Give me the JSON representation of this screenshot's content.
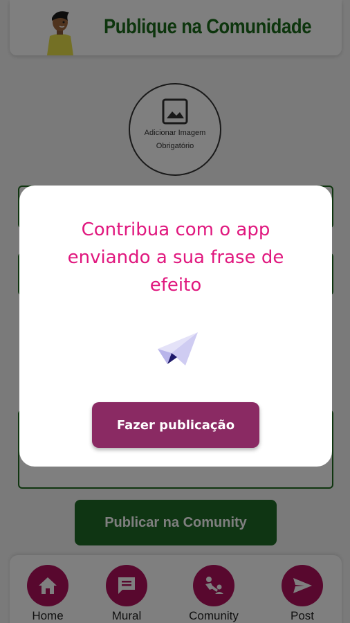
{
  "header": {
    "title": "Publique na Comunidade",
    "avatar_icon": "person-avatar-icon"
  },
  "image_picker": {
    "label_line1": "Adicionar Imagem",
    "label_line2": "Obrigatório",
    "icon": "image-icon"
  },
  "publish_button": {
    "label": "Publicar na Comunity"
  },
  "bottom_nav": {
    "items": [
      {
        "label": "Home",
        "icon": "home-icon"
      },
      {
        "label": "Mural",
        "icon": "chat-icon"
      },
      {
        "label": "Comunity",
        "icon": "community-icon"
      },
      {
        "label": "Post",
        "icon": "send-icon"
      }
    ]
  },
  "modal": {
    "message": "Contribua com o app enviando a sua frase de efeito",
    "icon": "paper-plane-icon",
    "button_label": "Fazer publicação"
  },
  "colors": {
    "primary_green": "#1f6b26",
    "accent_pink": "#e0177e",
    "nav_magenta": "#b0105c",
    "modal_button": "#8a2a63"
  }
}
